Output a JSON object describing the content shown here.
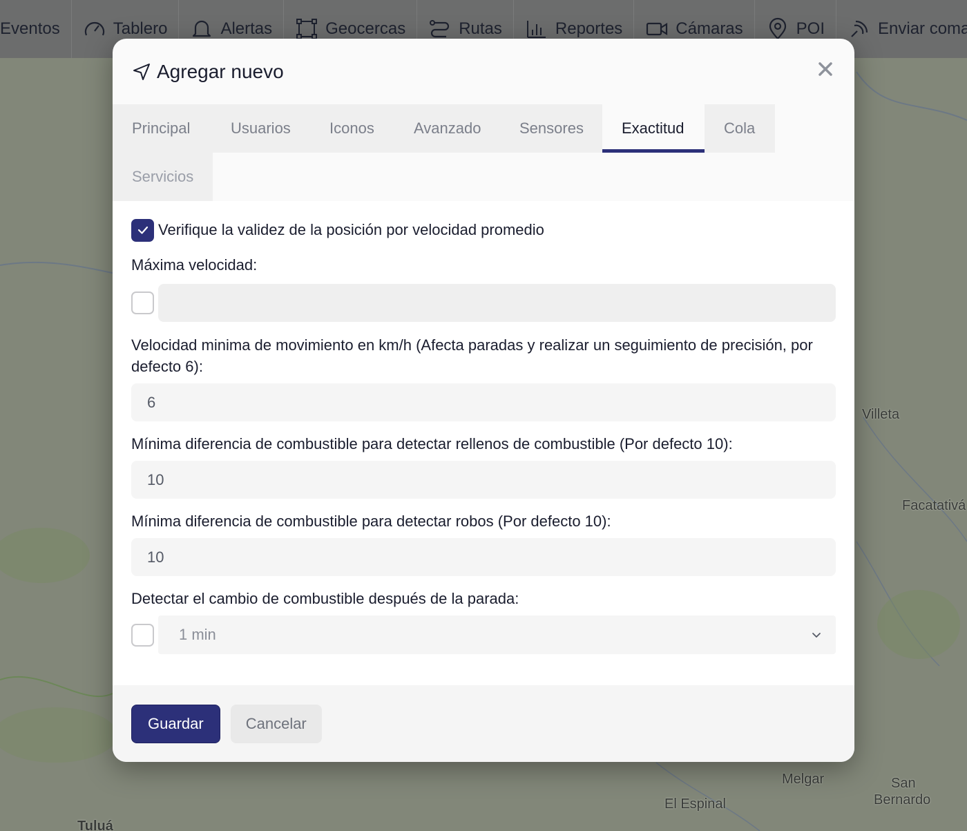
{
  "navbar": {
    "items": [
      {
        "label": "Eventos",
        "icon": "events-icon"
      },
      {
        "label": "Tablero",
        "icon": "gauge-icon"
      },
      {
        "label": "Alertas",
        "icon": "bell-icon"
      },
      {
        "label": "Geocercas",
        "icon": "geofence-icon"
      },
      {
        "label": "Rutas",
        "icon": "route-icon"
      },
      {
        "label": "Reportes",
        "icon": "bar-chart-icon"
      },
      {
        "label": "Cámaras",
        "icon": "video-camera-icon"
      },
      {
        "label": "POI",
        "icon": "map-pin-icon"
      },
      {
        "label": "Enviar comando",
        "icon": "signal-icon"
      }
    ]
  },
  "map": {
    "labels": [
      "Villeta",
      "Facatativá",
      "Melgar",
      "El Espinal",
      "San",
      "Bernardo",
      "Tuluá"
    ]
  },
  "modal": {
    "title": "Agregar nuevo",
    "title_icon": "send-arrow-icon",
    "close_icon": "close-icon",
    "tabs": [
      {
        "label": "Principal",
        "active": false
      },
      {
        "label": "Usuarios",
        "active": false
      },
      {
        "label": "Iconos",
        "active": false
      },
      {
        "label": "Avanzado",
        "active": false
      },
      {
        "label": "Sensores",
        "active": false
      },
      {
        "label": "Exactitud",
        "active": true
      },
      {
        "label": "Cola",
        "active": false
      },
      {
        "label": "Servicios",
        "active": false
      }
    ],
    "form": {
      "validate_checkbox_label": "Verifique la validez de la posición por velocidad promedio",
      "validate_checked": true,
      "max_speed_label": "Máxima velocidad:",
      "max_speed_value": "",
      "max_speed_checked": false,
      "min_speed_label": "Velocidad minima de movimiento en km/h (Afecta paradas y realizar un seguimiento de precisión, por defecto 6):",
      "min_speed_value": "6",
      "fuel_fill_label": "Mínima diferencia de combustible para detectar rellenos de combustible (Por defecto 10):",
      "fuel_fill_value": "10",
      "fuel_theft_label": "Mínima diferencia de combustible para detectar robos (Por defecto 10):",
      "fuel_theft_value": "10",
      "fuel_change_label": "Detectar el cambio de combustible después de la parada:",
      "fuel_change_checked": false,
      "fuel_change_selected": "1 min"
    },
    "footer": {
      "save_label": "Guardar",
      "cancel_label": "Cancelar"
    }
  },
  "colors": {
    "primary": "#2c3079",
    "map_background": "#858a7c",
    "navbar_background": "#6f7070"
  }
}
